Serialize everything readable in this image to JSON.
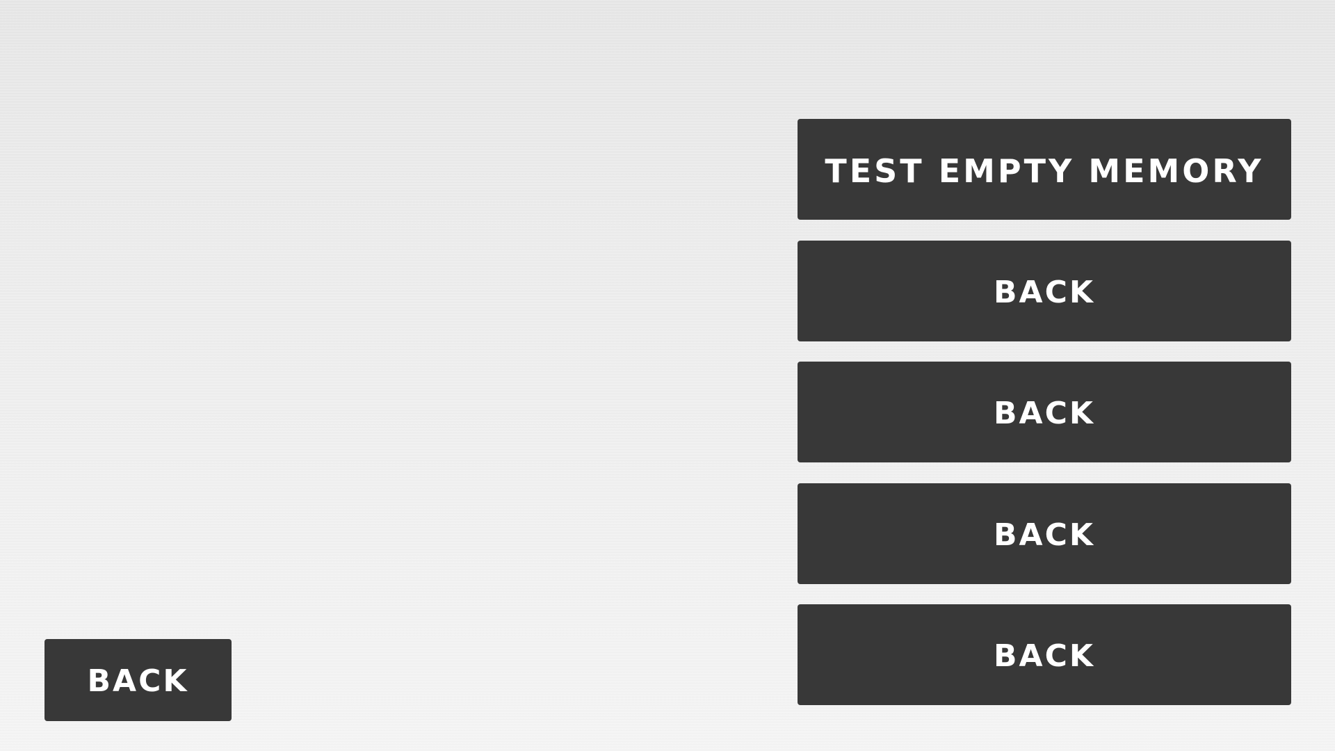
{
  "right_menu": {
    "buttons": [
      {
        "label": "TEST EMPTY MEMORY"
      },
      {
        "label": "BACK"
      },
      {
        "label": "BACK"
      },
      {
        "label": "BACK"
      },
      {
        "label": "BACK"
      }
    ]
  },
  "corner": {
    "back_label": "BACK"
  },
  "colors": {
    "button_bg": "#383838",
    "button_text": "#ffffff",
    "background": "#ececec"
  }
}
